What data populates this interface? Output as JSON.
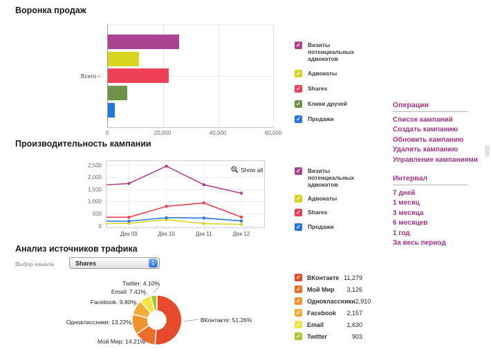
{
  "chart_data": [
    {
      "type": "bar",
      "orientation": "horizontal",
      "title": "Воронка продаж",
      "row_label": "Всего",
      "x_axis": {
        "ticks": [
          "0",
          "20,000",
          "40,000",
          "60,000"
        ],
        "max": 60000,
        "grid": true
      },
      "bars": [
        {
          "label": "Визиты потенциальных адвокатов",
          "value": 25650,
          "color": "#ab4291"
        },
        {
          "label": "Адвокаты",
          "value": 11200,
          "color": "#d9d420"
        },
        {
          "label": "Shares",
          "value": 22005,
          "color": "#ee4056"
        },
        {
          "label": "Клики друзей",
          "value": 6900,
          "color": "#6f9249"
        },
        {
          "label": "Продажи",
          "value": 2600,
          "color": "#2376dd"
        }
      ]
    },
    {
      "type": "line",
      "title": "Производительность кампании",
      "button_label": "Show all",
      "y_axis": {
        "ticks": [
          "0",
          "500",
          "1,000",
          "1,500",
          "2,000",
          "2,500"
        ],
        "tick_values": [
          0,
          500,
          1000,
          1500,
          2000,
          2500
        ],
        "max": 2500,
        "grid": true
      },
      "x_labels": [
        "Дек 09",
        "Дек 10",
        "Дек 11",
        "Дек 12"
      ],
      "series": [
        {
          "name": "Визиты потенциальных адвокатов",
          "color": "#ab4291",
          "values": [
            1690,
            1750,
            2460,
            1700,
            1350
          ]
        },
        {
          "name": "Адвокаты",
          "color": "#d9d420",
          "values": [
            100,
            110,
            260,
            100,
            70
          ]
        },
        {
          "name": "Shares",
          "color": "#e73e51",
          "values": [
            360,
            360,
            810,
            950,
            370
          ]
        },
        {
          "name": "Продажи",
          "color": "#2376dd",
          "values": [
            200,
            200,
            340,
            330,
            210
          ]
        }
      ]
    },
    {
      "type": "pie",
      "title": "Анализ источников трафика",
      "channel_label": "Выбор канала",
      "channel_value": "Shares",
      "slices": [
        {
          "name": "ВКонтакте",
          "pct": 51.26,
          "pct_label": "51.26%",
          "value": "11,279",
          "color": "#e84a2c"
        },
        {
          "name": "Мой Мир",
          "pct": 14.21,
          "pct_label": "14.21%",
          "value": "3,126",
          "color": "#eb6d26"
        },
        {
          "name": "Одноклассники",
          "pct": 13.22,
          "pct_label": "13.22%",
          "value": "2,910",
          "color": "#f0932f"
        },
        {
          "name": "Facebook",
          "pct": 9.8,
          "pct_label": "9.80%",
          "value": "2,157",
          "color": "#f2ad38"
        },
        {
          "name": "Email",
          "pct": 7.41,
          "pct_label": "7.41%",
          "value": "1,630",
          "color": "#f5e243"
        },
        {
          "name": "Twitter",
          "pct": 4.1,
          "pct_label": "4.10%",
          "value": "903",
          "color": "#a7c933"
        }
      ]
    }
  ],
  "sidebar": {
    "operations": {
      "header": "Операции",
      "links": [
        "Список кампаний",
        "Создать кампанию",
        "Обновить кампанию",
        "Удалить кампанию",
        "Управление кампаниями"
      ]
    },
    "interval": {
      "header": "Интервал",
      "links": [
        "7 дней",
        "1 месяц",
        "3 месяца",
        "6 месяцев",
        "1 год",
        "За весь период"
      ]
    }
  }
}
